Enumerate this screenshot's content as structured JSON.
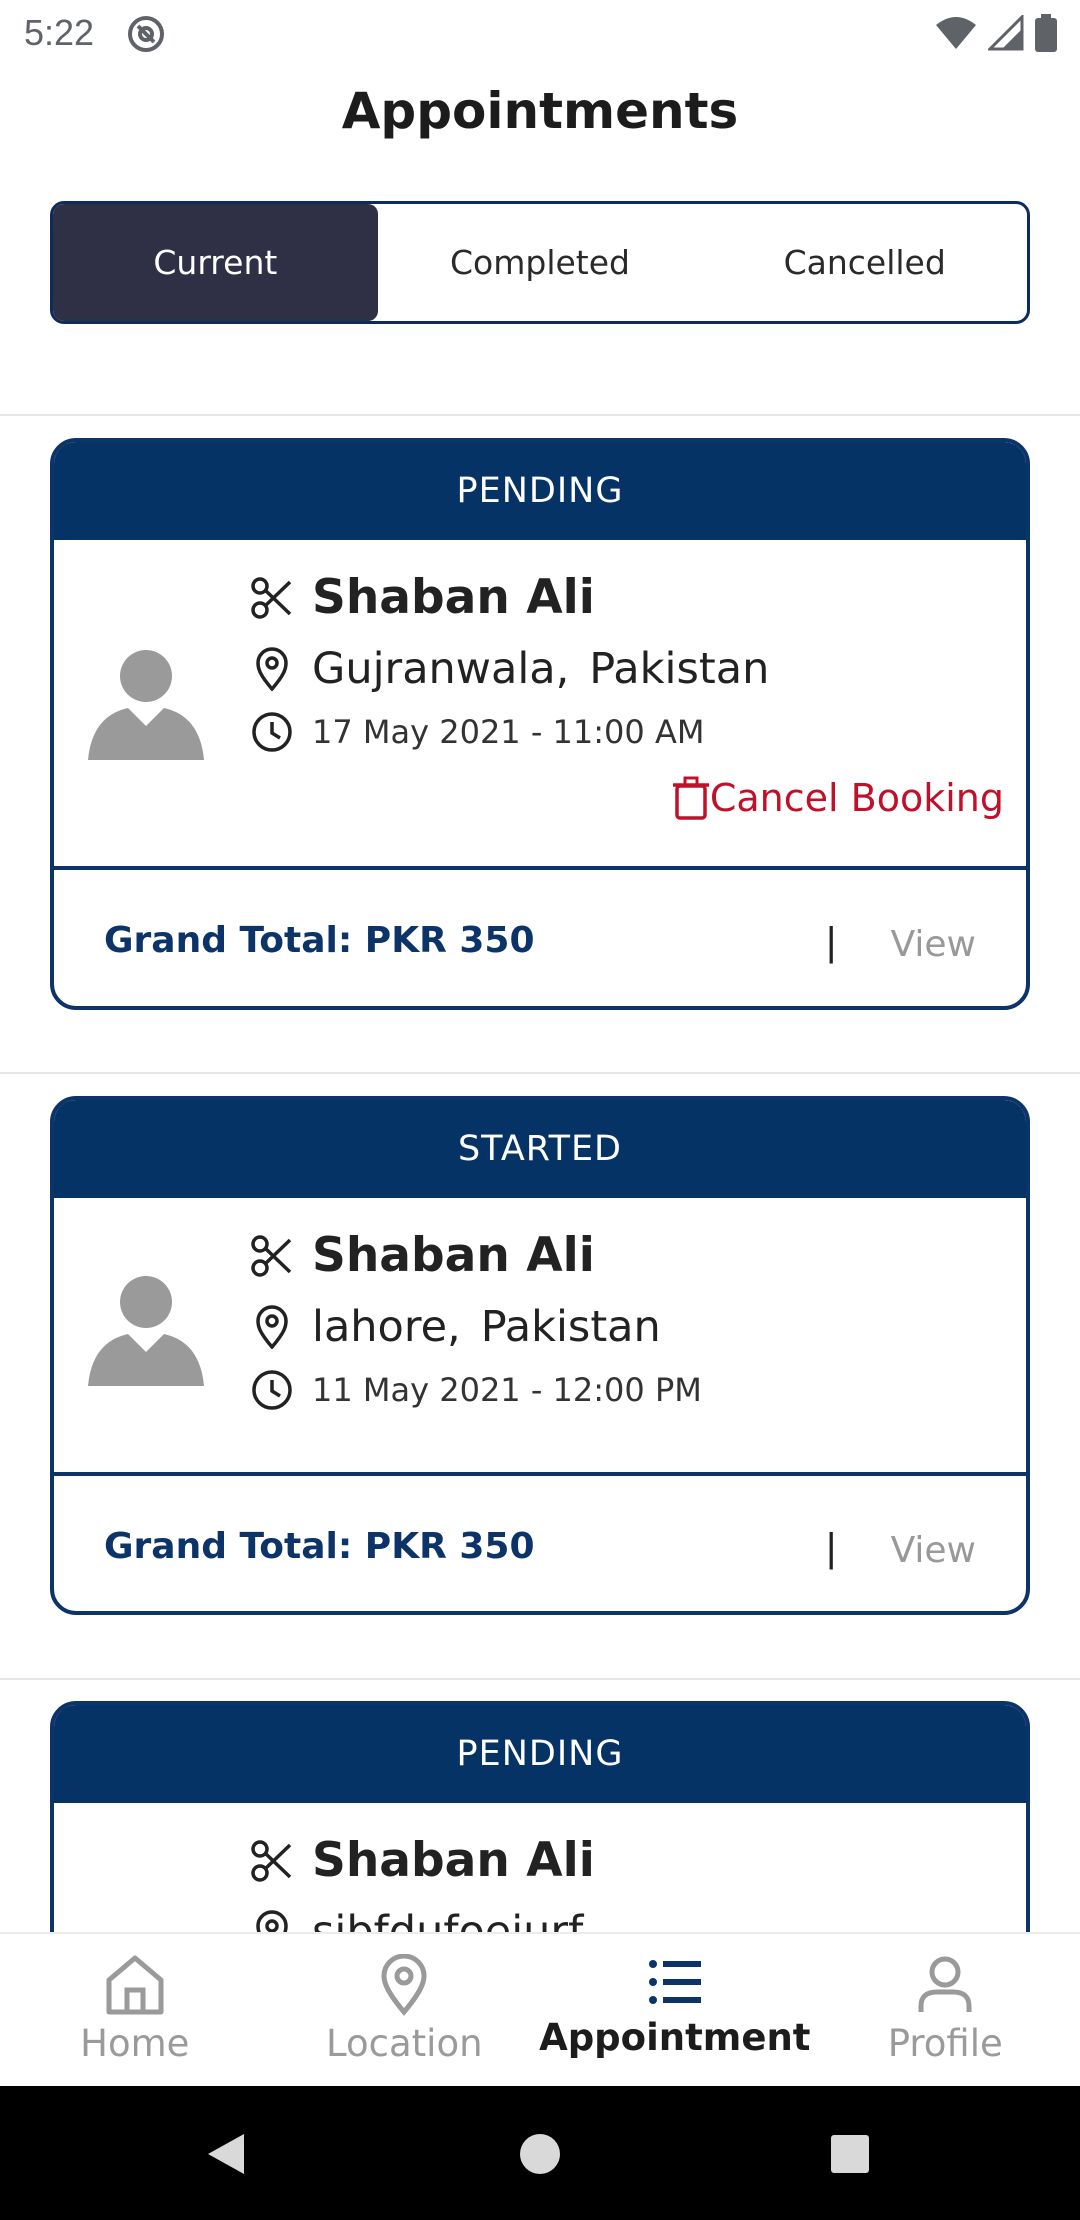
{
  "status_bar": {
    "time": "5:22"
  },
  "header": {
    "title": "Appointments"
  },
  "tabs": [
    {
      "label": "Current",
      "active": true
    },
    {
      "label": "Completed",
      "active": false
    },
    {
      "label": "Cancelled",
      "active": false
    }
  ],
  "appointments": [
    {
      "status": "PENDING",
      "name": "Shaban Ali",
      "city": "Gujranwala,",
      "country": "Pakistan",
      "datetime": "17 May 2021 - 11:00 AM",
      "cancel_label": "Cancel Booking",
      "grand_total": "Grand Total: PKR 350",
      "pipe": "|",
      "view_label": "View"
    },
    {
      "status": "STARTED",
      "name": "Shaban Ali",
      "city": "lahore,",
      "country": "Pakistan",
      "datetime": "11 May 2021 - 12:00 PM",
      "grand_total": "Grand Total: PKR 350",
      "pipe": "|",
      "view_label": "View"
    },
    {
      "status": "PENDING",
      "name": "Shaban Ali",
      "city": "sjbfdufoeiurf"
    }
  ],
  "bottom_nav": [
    {
      "label": "Home",
      "icon": "home-icon"
    },
    {
      "label": "Location",
      "icon": "location-icon"
    },
    {
      "label": "Appointment",
      "icon": "list-icon",
      "active": true
    },
    {
      "label": "Profile",
      "icon": "person-icon"
    }
  ],
  "colors": {
    "primary": "#063366",
    "active_tab": "#2f2f45",
    "cancel": "#c0102a",
    "muted": "#9a9a9a"
  }
}
